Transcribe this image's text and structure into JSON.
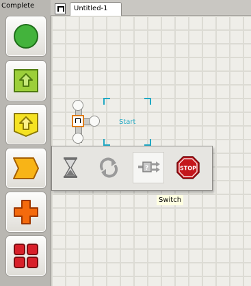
{
  "palette": {
    "title": "Complete",
    "buttons": [
      {
        "name": "common-blocks-palette-button",
        "icon": "green-circle-icon"
      },
      {
        "name": "action-blocks-palette-button",
        "icon": "green-arrow-up-icon"
      },
      {
        "name": "sensor-blocks-palette-button",
        "icon": "yellow-arrow-up-icon"
      },
      {
        "name": "flow-blocks-palette-button",
        "icon": "orange-chevron-icon"
      },
      {
        "name": "data-blocks-palette-button",
        "icon": "orange-plus-icon"
      },
      {
        "name": "advanced-blocks-palette-button",
        "icon": "red-grid-icon"
      }
    ]
  },
  "tabs": [
    {
      "label": "Untitled-1"
    }
  ],
  "canvas": {
    "start_label": "Start"
  },
  "flyout": {
    "items": [
      {
        "name": "wait-block",
        "icon": "hourglass-icon"
      },
      {
        "name": "loop-block",
        "icon": "loop-arrows-icon"
      },
      {
        "name": "switch-block",
        "icon": "switch-icon"
      },
      {
        "name": "stop-block",
        "icon": "stop-sign-icon",
        "text": "STOP"
      }
    ]
  },
  "tooltip": {
    "text": "Switch"
  },
  "colors": {
    "accent": "#21a9c4",
    "start_block_border": "#e07c12"
  }
}
